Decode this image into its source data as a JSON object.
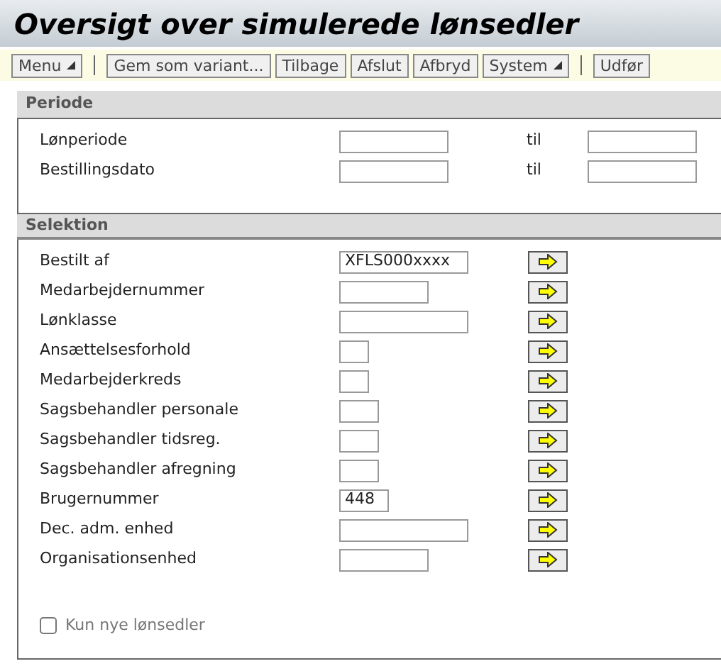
{
  "window": {
    "title": "Oversigt over simulerede lønsedler"
  },
  "toolbar": [
    {
      "kind": "button",
      "label": "Menu",
      "dropdown": true
    },
    {
      "kind": "separator"
    },
    {
      "kind": "button",
      "label": "Gem som variant...",
      "dropdown": false
    },
    {
      "kind": "button",
      "label": "Tilbage",
      "dropdown": false
    },
    {
      "kind": "button",
      "label": "Afslut",
      "dropdown": false
    },
    {
      "kind": "button",
      "label": "Afbryd",
      "dropdown": false
    },
    {
      "kind": "button",
      "label": "System",
      "dropdown": true
    },
    {
      "kind": "separator"
    },
    {
      "kind": "button",
      "label": "Udfør",
      "dropdown": false
    }
  ],
  "periode": {
    "title": "Periode",
    "rows": [
      {
        "label": "Lønperiode",
        "to_label": "til"
      },
      {
        "label": "Bestillingsdato",
        "to_label": "til"
      }
    ]
  },
  "selektion": {
    "title": "Selektion",
    "rows": [
      {
        "label": "Bestilt af",
        "value": "XFLS000xxxx"
      },
      {
        "label": "Medarbejdernummer"
      },
      {
        "label": "Lønklasse"
      },
      {
        "label": "Ansættelsesforhold"
      },
      {
        "label": "Medarbejderkreds"
      },
      {
        "label": "Sagsbehandler personale"
      },
      {
        "label": "Sagsbehandler tidsreg."
      },
      {
        "label": "Sagsbehandler afregning"
      },
      {
        "label": "Brugernummer",
        "value": "448"
      },
      {
        "label": "Dec. adm. enhed"
      },
      {
        "label": "Organisationsenhed"
      }
    ],
    "checkbox": {
      "label": "Kun nye lønsedler",
      "checked": false
    }
  }
}
